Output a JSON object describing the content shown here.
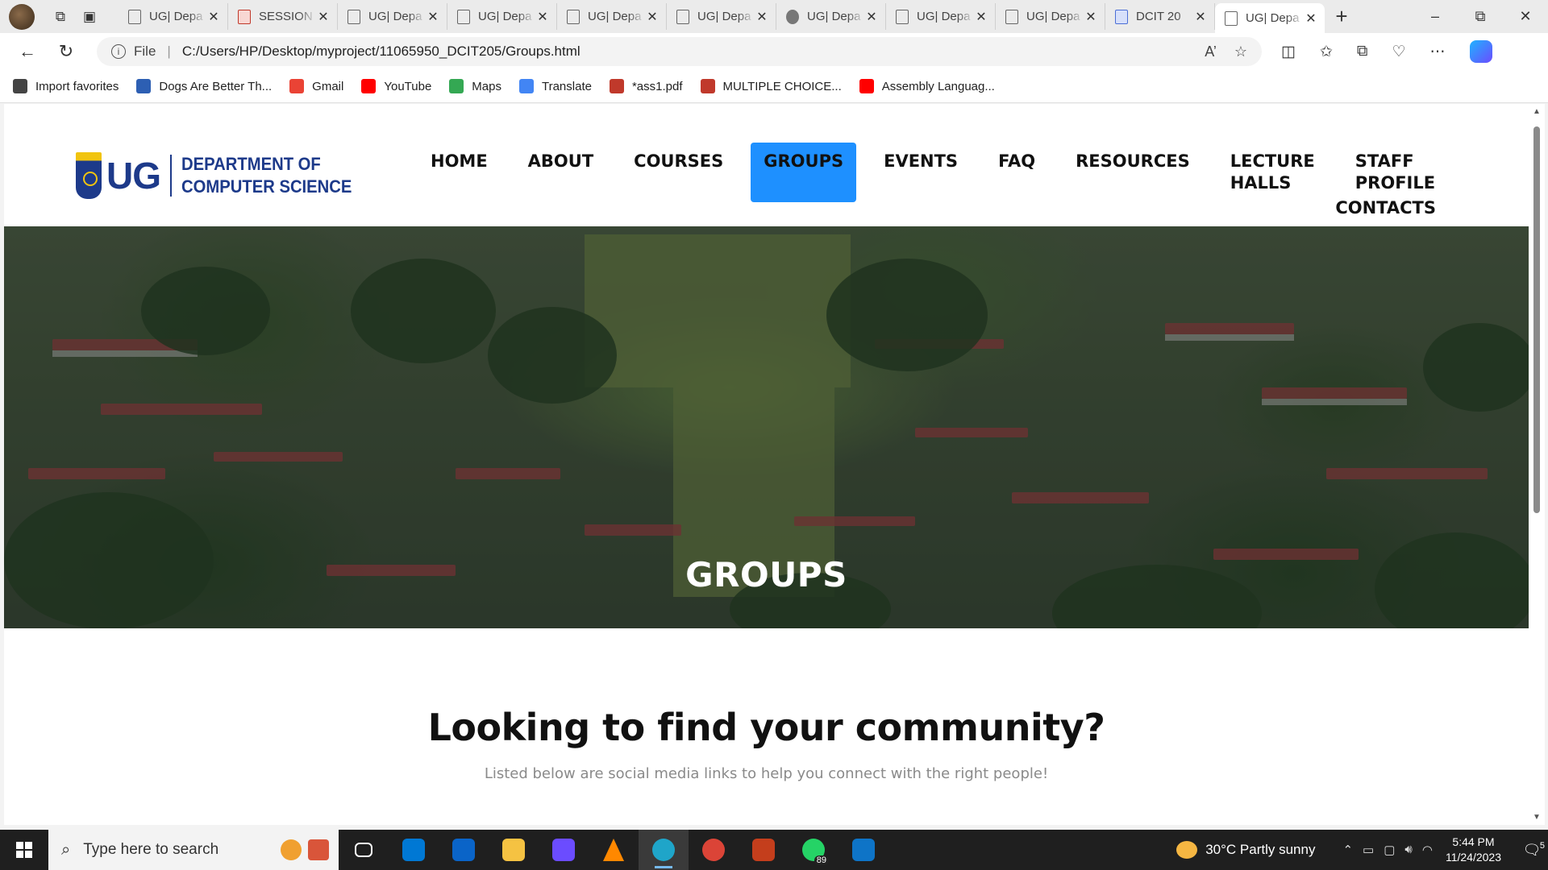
{
  "browser": {
    "tabs": [
      {
        "title": "UG| Depa",
        "icon": "page-icon",
        "active": false
      },
      {
        "title": "SESSION",
        "icon": "pdf-icon",
        "active": false
      },
      {
        "title": "UG| Depa",
        "icon": "page-icon",
        "active": false
      },
      {
        "title": "UG| Depa",
        "icon": "page-icon",
        "active": false
      },
      {
        "title": "UG| Depa",
        "icon": "page-icon",
        "active": false
      },
      {
        "title": "UG| Depa",
        "icon": "page-icon",
        "active": false
      },
      {
        "title": "UG| Depa",
        "icon": "shield-icon",
        "active": false
      },
      {
        "title": "UG| Depa",
        "icon": "page-icon",
        "active": false
      },
      {
        "title": "UG| Depa",
        "icon": "page-icon",
        "active": false
      },
      {
        "title": "DCIT 20",
        "icon": "doc-icon",
        "active": false
      },
      {
        "title": "UG| Depa",
        "icon": "page-icon",
        "active": true
      }
    ],
    "address": {
      "scheme": "File",
      "url": "C:/Users/HP/Desktop/myproject/11065950_DCIT205/Groups.html"
    },
    "favorites": [
      {
        "label": "Import favorites",
        "icon": "import-icon",
        "color": "#444444"
      },
      {
        "label": "Dogs Are Better Th...",
        "icon": "eb-icon",
        "color": "#2d5fb3"
      },
      {
        "label": "Gmail",
        "icon": "gmail-icon",
        "color": "#ea4335"
      },
      {
        "label": "YouTube",
        "icon": "youtube-icon",
        "color": "#ff0000"
      },
      {
        "label": "Maps",
        "icon": "maps-icon",
        "color": "#34a853"
      },
      {
        "label": "Translate",
        "icon": "translate-icon",
        "color": "#4285f4"
      },
      {
        "label": "*ass1.pdf",
        "icon": "pdf-icon",
        "color": "#c0392b"
      },
      {
        "label": "MULTIPLE CHOICE...",
        "icon": "pdf-icon",
        "color": "#c0392b"
      },
      {
        "label": "Assembly Languag...",
        "icon": "youtube-icon",
        "color": "#ff0000"
      }
    ]
  },
  "site": {
    "logo": {
      "short": "UG",
      "dept_line1": "DEPARTMENT OF",
      "dept_line2": "COMPUTER SCIENCE"
    },
    "nav": [
      {
        "label": "HOME",
        "active": false
      },
      {
        "label": "ABOUT",
        "active": false
      },
      {
        "label": "COURSES",
        "active": false
      },
      {
        "label": "GROUPS",
        "active": true
      },
      {
        "label": "EVENTS",
        "active": false
      },
      {
        "label": "FAQ",
        "active": false
      },
      {
        "label": "RESOURCES",
        "active": false
      },
      {
        "label": "LECTURE HALLS",
        "active": false
      },
      {
        "label": "STAFF PROFILE",
        "active": false
      },
      {
        "label": "CONTACTS",
        "active": false
      }
    ],
    "hero_title": "GROUPS",
    "intro": {
      "heading": "Looking to find your community?",
      "subtext": "Listed below are social media links to help you connect with the right people!"
    },
    "accent_color": "#1e90ff",
    "brand_color": "#1d3a8a"
  },
  "taskbar": {
    "search_placeholder": "Type here to search",
    "apps": [
      {
        "name": "task-view-icon",
        "color": "#1f1f1f",
        "running": false
      },
      {
        "name": "microsoft-store-icon",
        "color": "#0078d4",
        "running": false
      },
      {
        "name": "mail-icon",
        "color": "#0a64c8",
        "running": false
      },
      {
        "name": "file-explorer-icon",
        "color": "#f5c242",
        "running": false
      },
      {
        "name": "clipchamp-icon",
        "color": "#6b4cff",
        "running": false
      },
      {
        "name": "vlc-icon",
        "color": "#ff8800",
        "running": false
      },
      {
        "name": "edge-icon",
        "color": "#1fa5c9",
        "running": true
      },
      {
        "name": "chrome-icon",
        "color": "#db4437",
        "running": false
      },
      {
        "name": "powerpoint-icon",
        "color": "#c43e1c",
        "running": false
      },
      {
        "name": "whatsapp-icon",
        "color": "#25d366",
        "running": false,
        "badge": "89"
      },
      {
        "name": "vscode-icon",
        "color": "#0e74c7",
        "running": false
      }
    ],
    "weather": "30°C  Partly sunny",
    "time": "5:44 PM",
    "date": "11/24/2023",
    "notification_count": "5"
  }
}
